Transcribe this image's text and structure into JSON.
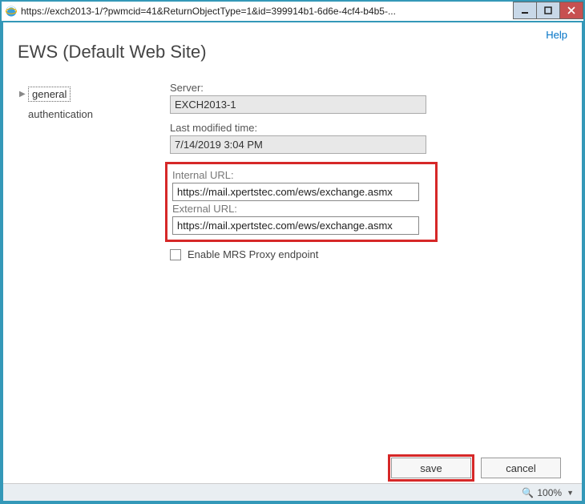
{
  "window": {
    "url": "https://exch2013-1/?pwmcid=41&ReturnObjectType=1&id=399914b1-6d6e-4cf4-b4b5-..."
  },
  "help_label": "Help",
  "page_title": "EWS (Default Web Site)",
  "nav": {
    "items": [
      {
        "label": "general",
        "active": true
      },
      {
        "label": "authentication",
        "active": false
      }
    ]
  },
  "form": {
    "server_label": "Server:",
    "server_value": "EXCH2013-1",
    "modified_label": "Last modified time:",
    "modified_value": "7/14/2019 3:04 PM",
    "internal_label": "Internal URL:",
    "internal_value": "https://mail.xpertstec.com/ews/exchange.asmx",
    "external_label": "External URL:",
    "external_value": "https://mail.xpertstec.com/ews/exchange.asmx",
    "mrs_label": "Enable MRS Proxy endpoint",
    "mrs_checked": false
  },
  "buttons": {
    "save": "save",
    "cancel": "cancel"
  },
  "status": {
    "zoom": "100%"
  }
}
